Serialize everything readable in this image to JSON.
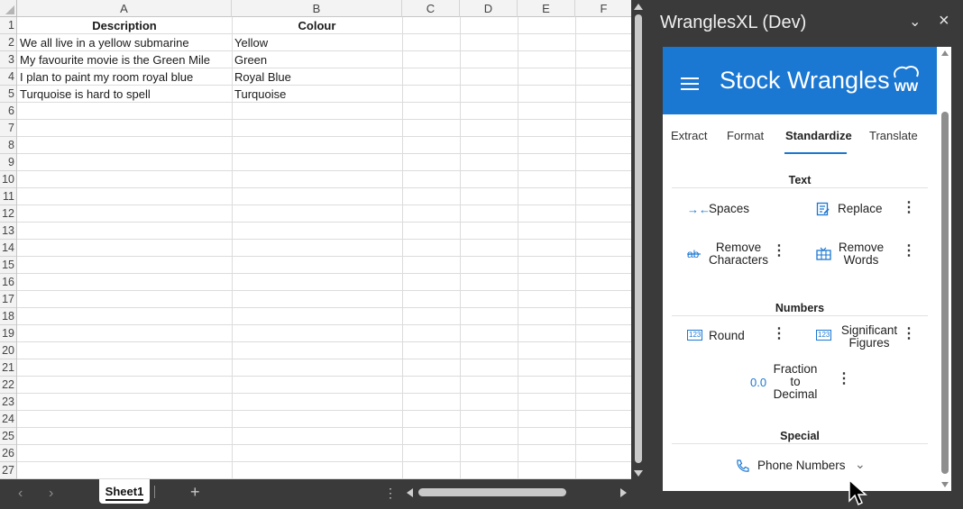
{
  "spreadsheet": {
    "columns": [
      "A",
      "B",
      "C",
      "D",
      "E",
      "F"
    ],
    "rows": [
      "1",
      "2",
      "3",
      "4",
      "5",
      "6",
      "7",
      "8",
      "9",
      "10",
      "11",
      "12",
      "13",
      "14",
      "15",
      "16",
      "17",
      "18",
      "19",
      "20",
      "21",
      "22",
      "23",
      "24",
      "25",
      "26",
      "27"
    ],
    "header_row": {
      "a": "Description",
      "b": "Colour"
    },
    "data": [
      {
        "a": "We all live in a yellow submarine",
        "b": "Yellow"
      },
      {
        "a": "My favourite movie is the Green Mile",
        "b": "Green"
      },
      {
        "a": "I plan to paint my room royal blue",
        "b": "Royal Blue"
      },
      {
        "a": "Turquoise is hard to spell",
        "b": "Turquoise"
      }
    ]
  },
  "sheetbar": {
    "prev_icon": "chevron-left-icon",
    "next_icon": "chevron-right-icon",
    "active_sheet": "Sheet1",
    "add_icon": "plus-icon",
    "more_icon": "vertical-ellipsis-icon"
  },
  "taskpane": {
    "title": "WranglesXL (Dev)",
    "collapse_icon": "chevron-down-icon",
    "close_icon": "close-icon"
  },
  "addin": {
    "brand": "Stock Wrangles",
    "logo_text": "WW",
    "brand_color": "#1a77d2",
    "tabs": [
      "Extract",
      "Format",
      "Standardize",
      "Translate"
    ],
    "active_tab": "Standardize",
    "sections": {
      "text": {
        "title": "Text",
        "tools": [
          {
            "label": "Spaces",
            "icon": "spaces-icon"
          },
          {
            "label": "Replace",
            "icon": "replace-icon"
          },
          {
            "label_1": "Remove",
            "label_2": "Characters",
            "icon": "remove-characters-icon"
          },
          {
            "label_1": "Remove",
            "label_2": "Words",
            "icon": "remove-words-icon"
          }
        ]
      },
      "numbers": {
        "title": "Numbers",
        "tools": [
          {
            "label": "Round",
            "icon": "round-icon",
            "icon_text": "123"
          },
          {
            "label_1": "Significant",
            "label_2": "Figures",
            "icon": "significant-figures-icon",
            "icon_text": "123"
          },
          {
            "label_1": "Fraction",
            "label_2": "to",
            "label_3": "Decimal",
            "icon": "fraction-to-decimal-icon",
            "icon_text": "0.0"
          }
        ]
      },
      "special": {
        "title": "Special",
        "tools": [
          {
            "label": "Phone Numbers",
            "icon": "phone-icon",
            "dropdown_icon": "chevron-down-icon"
          }
        ]
      }
    }
  }
}
